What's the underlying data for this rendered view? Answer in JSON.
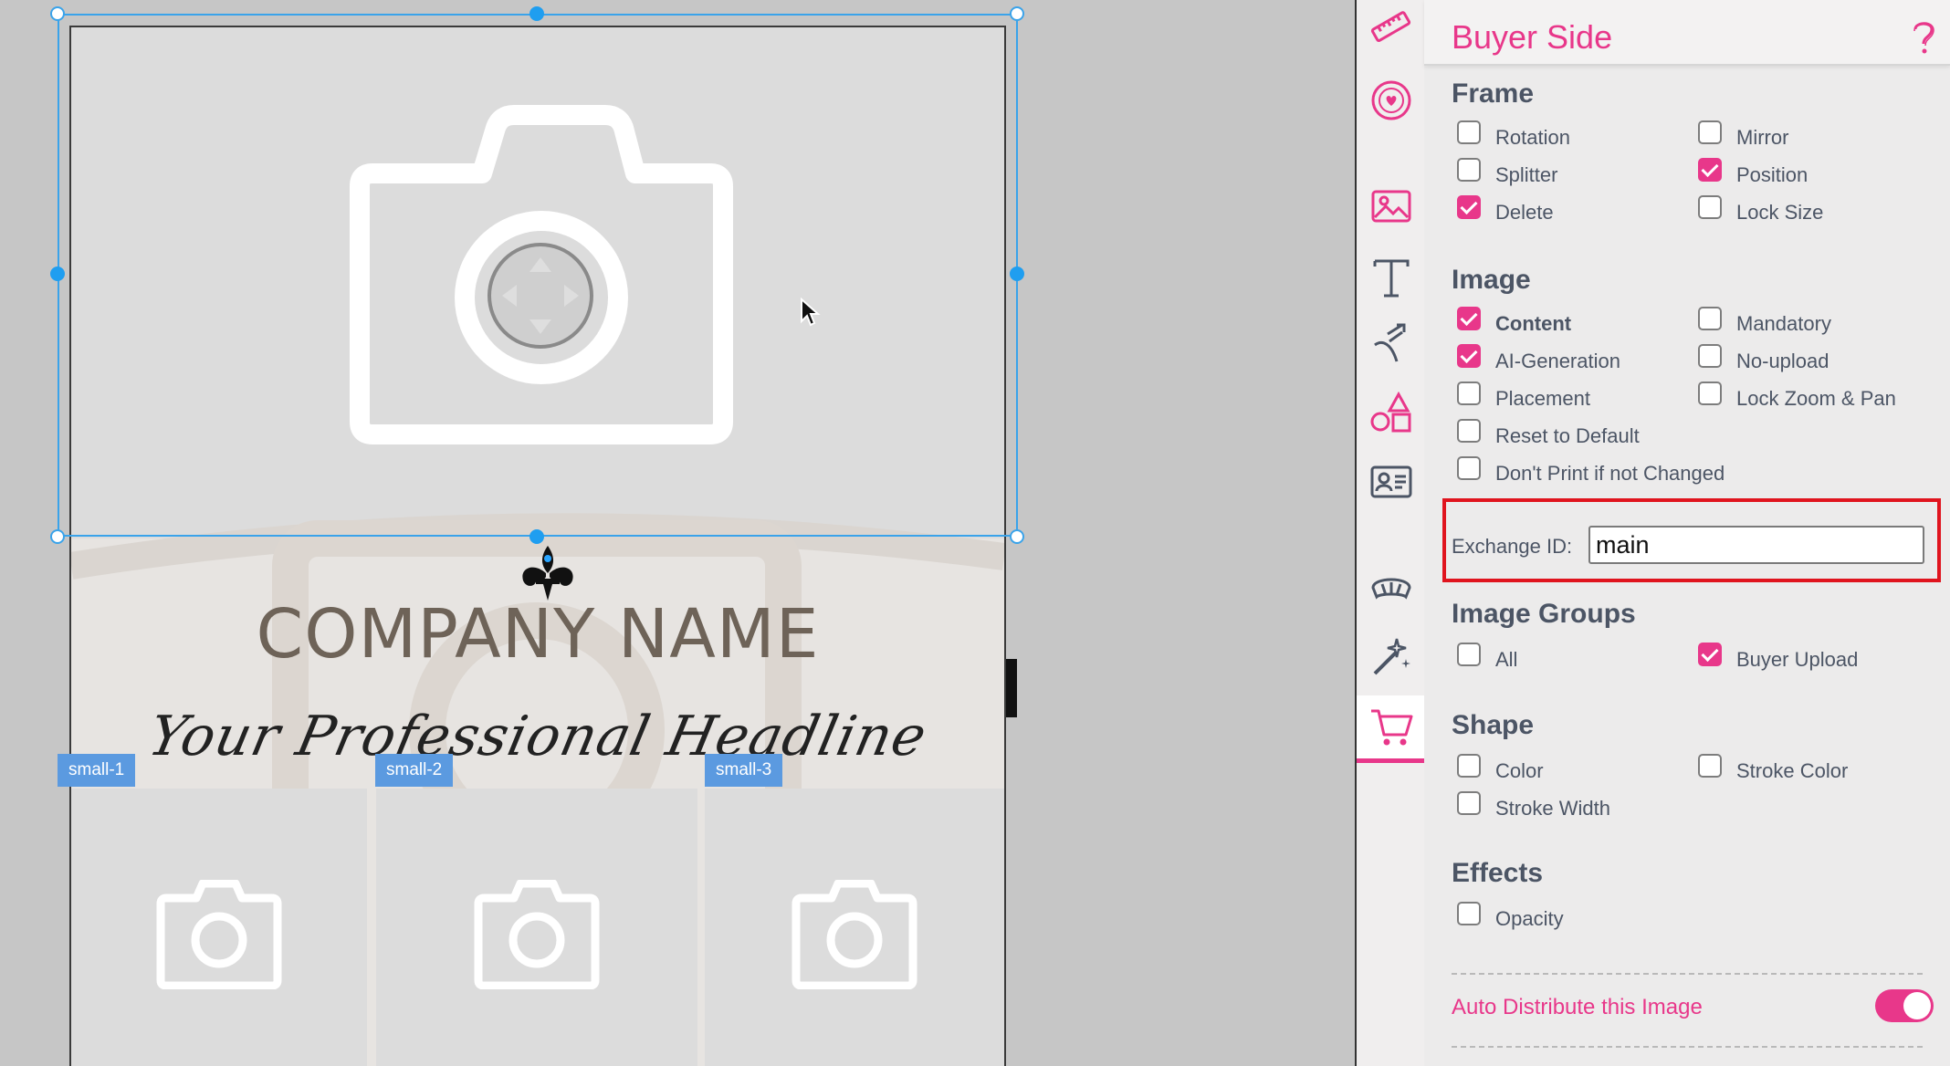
{
  "canvas": {
    "company_name": "COMPANY NAME",
    "headline": "Your Professional Headline",
    "small_frames": [
      {
        "tag": "small-1"
      },
      {
        "tag": "small-2"
      },
      {
        "tag": "small-3"
      }
    ]
  },
  "toolbar": {
    "tools": [
      {
        "icon": "ruler-icon"
      },
      {
        "icon": "heart-badge-icon"
      },
      {
        "icon": "image-icon"
      },
      {
        "icon": "text-icon"
      },
      {
        "icon": "path-icon"
      },
      {
        "icon": "shapes-icon"
      },
      {
        "icon": "contact-card-icon"
      },
      {
        "icon": "mask-icon"
      },
      {
        "icon": "magic-wand-icon"
      },
      {
        "icon": "cart-icon",
        "active": true
      }
    ]
  },
  "panel": {
    "title": "Buyer Side",
    "frame": {
      "title": "Frame",
      "options": [
        {
          "label": "Rotation",
          "checked": false
        },
        {
          "label": "Mirror",
          "checked": false
        },
        {
          "label": "Splitter",
          "checked": false
        },
        {
          "label": "Position",
          "checked": true
        },
        {
          "label": "Delete",
          "checked": true
        },
        {
          "label": "Lock Size",
          "checked": false
        }
      ]
    },
    "image": {
      "title": "Image",
      "options": [
        {
          "label": "Content",
          "checked": true
        },
        {
          "label": "Mandatory",
          "checked": false
        },
        {
          "label": "AI-Generation",
          "checked": true
        },
        {
          "label": "No-upload",
          "checked": false
        },
        {
          "label": "Placement",
          "checked": false
        },
        {
          "label": "Lock Zoom & Pan",
          "checked": false
        },
        {
          "label": "Reset to Default",
          "checked": false
        },
        {
          "label": "Don't Print if not Changed",
          "checked": false
        }
      ],
      "exchange_label": "Exchange ID:",
      "exchange_value": "main"
    },
    "image_groups": {
      "title": "Image Groups",
      "options": [
        {
          "label": "All",
          "checked": false
        },
        {
          "label": "Buyer Upload",
          "checked": true
        }
      ]
    },
    "shape": {
      "title": "Shape",
      "options": [
        {
          "label": "Color",
          "checked": false
        },
        {
          "label": "Stroke Color",
          "checked": false
        },
        {
          "label": "Stroke Width",
          "checked": false
        }
      ]
    },
    "effects": {
      "title": "Effects",
      "options": [
        {
          "label": "Opacity",
          "checked": false
        }
      ]
    },
    "auto_distribute": {
      "label": "Auto Distribute this Image",
      "enabled": true
    },
    "colors": {
      "accent": "#e8378a",
      "highlight": "#e0141e",
      "selection": "#3aa3ea"
    }
  }
}
